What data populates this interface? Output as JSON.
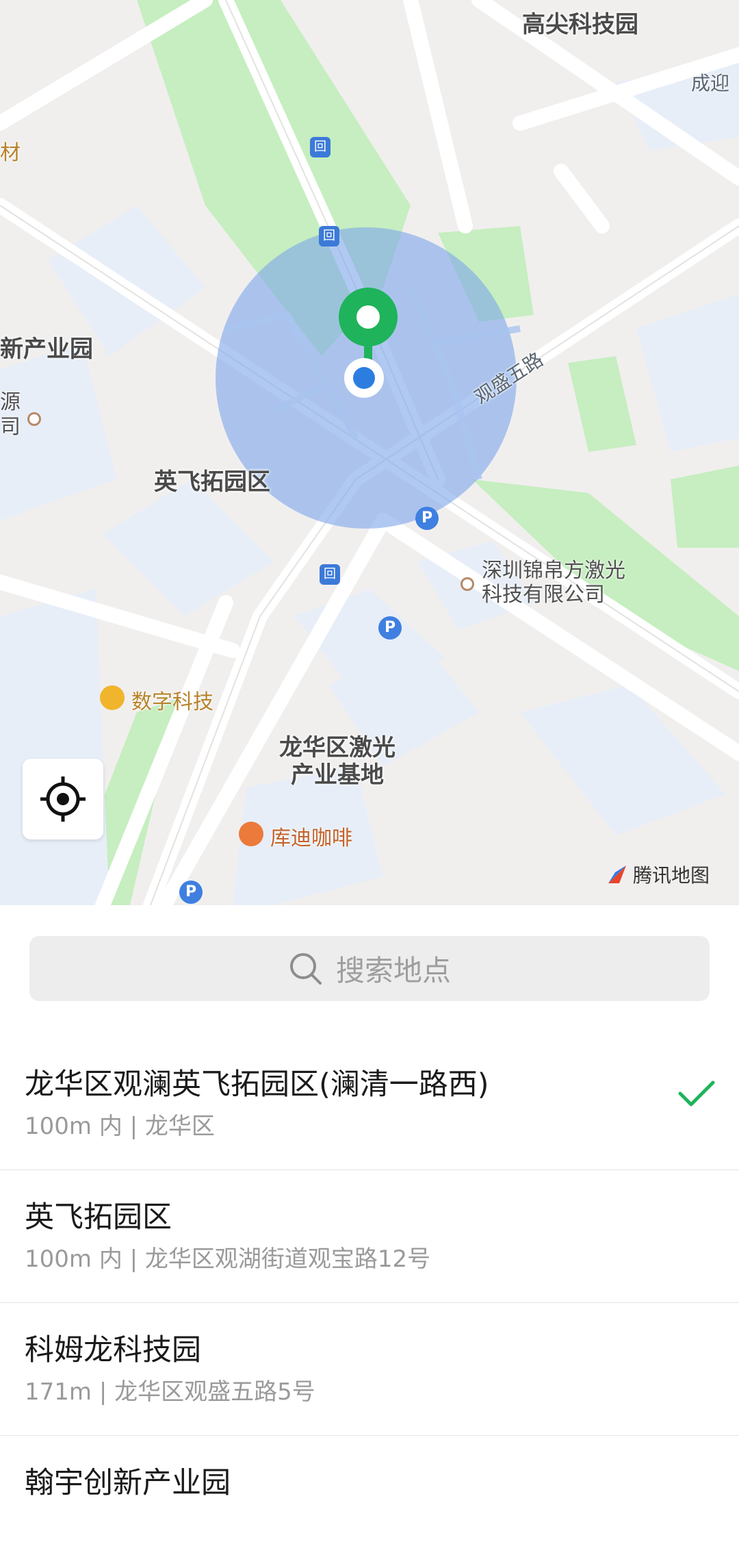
{
  "map": {
    "labels": {
      "gaojian": "高尖科技园",
      "chengying": "成迎",
      "cai": "材",
      "xinchanye": "新产业园",
      "yuan_si_1": "源",
      "yuan_si_2": "司",
      "yingfei": "英飞拓园区",
      "road_guansheng": "观盛五路",
      "jinbofang_1": "深圳锦帛方激光",
      "jinbofang_2": "科技有限公司",
      "shuzi": "数字科技",
      "longhua_laser_1": "龙华区激光",
      "longhua_laser_2": "产业基地",
      "kudi": "库迪咖啡"
    },
    "parking_symbol": "P",
    "metro_symbol": "回",
    "brand": "腾讯地图",
    "colors": {
      "accuracy_circle": "#7fa8ea",
      "pin": "#1fb35b",
      "location_dot": "#2b7ee0",
      "green_area": "#c6eec0"
    }
  },
  "search": {
    "placeholder": "搜索地点",
    "icon": "search-icon"
  },
  "results": [
    {
      "title": "龙华区观澜英飞拓园区(澜清一路西)",
      "subtitle": "100m 内 | 龙华区",
      "selected": true
    },
    {
      "title": "英飞拓园区",
      "subtitle": "100m 内 | 龙华区观湖街道观宝路12号",
      "selected": false
    },
    {
      "title": "科姆龙科技园",
      "subtitle": "171m | 龙华区观盛五路5号",
      "selected": false
    },
    {
      "title": "翰宇创新产业园",
      "subtitle": "",
      "selected": false
    }
  ]
}
